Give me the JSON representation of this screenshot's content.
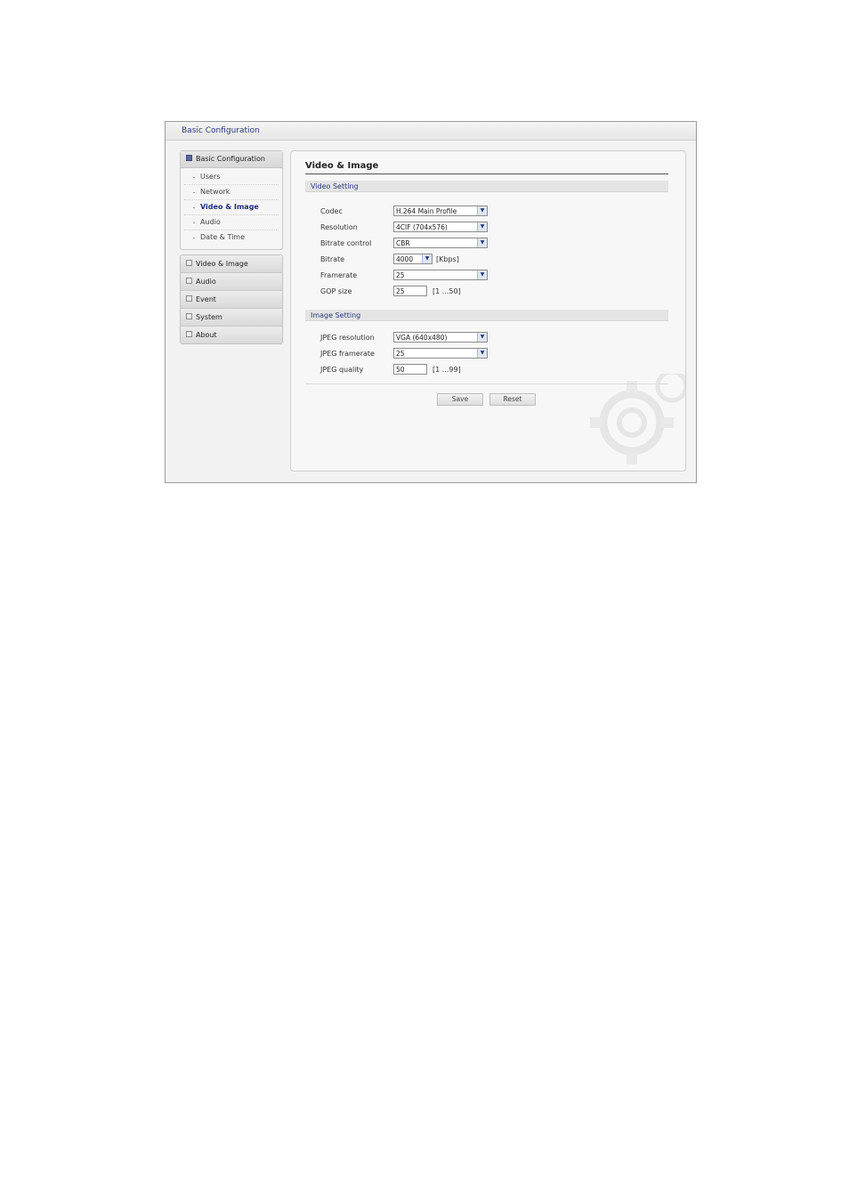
{
  "window": {
    "title": "Basic Configuration"
  },
  "sidebar": {
    "header": "Basic Configuration",
    "items": [
      {
        "label": "Users",
        "active": false
      },
      {
        "label": "Network",
        "active": false
      },
      {
        "label": "Video & Image",
        "active": true
      },
      {
        "label": "Audio",
        "active": false
      },
      {
        "label": "Date & Time",
        "active": false
      }
    ],
    "menu": [
      "Video & Image",
      "Audio",
      "Event",
      "System",
      "About"
    ]
  },
  "main": {
    "title": "Video & Image",
    "video_section": "Video Setting",
    "image_section": "Image Setting",
    "codec": {
      "label": "Codec",
      "value": "H.264 Main Profile"
    },
    "resolution": {
      "label": "Resolution",
      "value": "4CIF (704x576)"
    },
    "bitrate_control": {
      "label": "Bitrate control",
      "value": "CBR"
    },
    "bitrate": {
      "label": "Bitrate",
      "value": "4000",
      "unit": "[Kbps]"
    },
    "framerate": {
      "label": "Framerate",
      "value": "25"
    },
    "gop": {
      "label": "GOP size",
      "value": "25",
      "range": "[1 ...50]"
    },
    "jpeg_resolution": {
      "label": "JPEG resolution",
      "value": "VGA (640x480)"
    },
    "jpeg_framerate": {
      "label": "JPEG framerate",
      "value": "25"
    },
    "jpeg_quality": {
      "label": "JPEG quality",
      "value": "50",
      "range": "[1 ...99]"
    },
    "save_label": "Save",
    "reset_label": "Reset"
  },
  "colors": {
    "accent": "#1e2f7a",
    "panel": "#f7f7f7",
    "section": "#e4e4e4"
  }
}
